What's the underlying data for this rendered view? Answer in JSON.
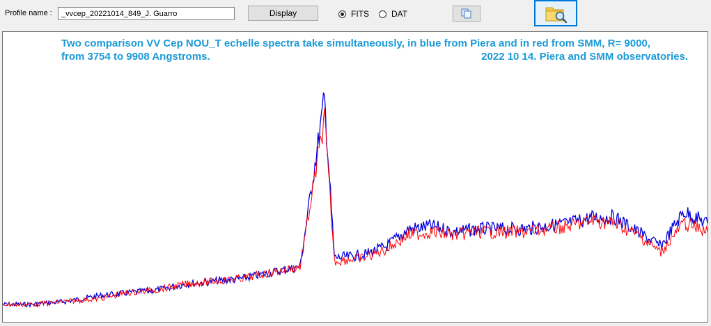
{
  "toolbar": {
    "profile_label": "Profile name :",
    "profile_value": "_vvcep_20221014_849_J. Guarro",
    "display_label": "Display",
    "fits_label": "FITS",
    "dat_label": "DAT",
    "selected_format": "FITS",
    "copy_icon": "copy-icon",
    "open_icon": "folder-search-icon"
  },
  "chart": {
    "caption_line1_left": "Two comparison  VV Cep NOU_T echelle spectra take simultaneously, in blue from Piera and in red from SMM, R= 9000,",
    "caption_line2_left": "from 3754 to 9908 Angstroms.",
    "caption_line2_right": "2022 10 14. Piera and SMM observatories.",
    "caption_color": "#1b9ad6"
  },
  "chart_data": {
    "type": "line",
    "title": "Two comparison  VV Cep NOU_T echelle spectra take simultaneously, in blue from Piera and in red from SMM, R= 9000, from 3754 to 9908 Angstroms. 2022 10 14. Piera and SMM observatories.",
    "xlabel": "",
    "ylabel": "",
    "xlim": [
      3754,
      9908
    ],
    "ylim": [
      0,
      1
    ],
    "grid": false,
    "x": [
      3754,
      4000,
      4300,
      4600,
      4850,
      5100,
      5350,
      5600,
      5850,
      6100,
      6350,
      6563,
      6650,
      6900,
      7100,
      7300,
      7500,
      7700,
      7900,
      8100,
      8300,
      8500,
      8700,
      8900,
      9100,
      9300,
      9500,
      9700,
      9908
    ],
    "series": [
      {
        "color": "#0000dd",
        "values": [
          0.06,
          0.06,
          0.07,
          0.09,
          0.1,
          0.11,
          0.13,
          0.14,
          0.15,
          0.17,
          0.19,
          0.77,
          0.22,
          0.23,
          0.26,
          0.32,
          0.33,
          0.31,
          0.32,
          0.32,
          0.32,
          0.33,
          0.34,
          0.36,
          0.36,
          0.31,
          0.26,
          0.38,
          0.34
        ]
      },
      {
        "color": "#ff0000",
        "values": [
          0.06,
          0.06,
          0.07,
          0.08,
          0.1,
          0.11,
          0.13,
          0.14,
          0.15,
          0.17,
          0.19,
          0.7,
          0.21,
          0.22,
          0.25,
          0.3,
          0.31,
          0.3,
          0.31,
          0.31,
          0.31,
          0.32,
          0.33,
          0.35,
          0.34,
          0.3,
          0.24,
          0.34,
          0.31
        ]
      }
    ]
  }
}
